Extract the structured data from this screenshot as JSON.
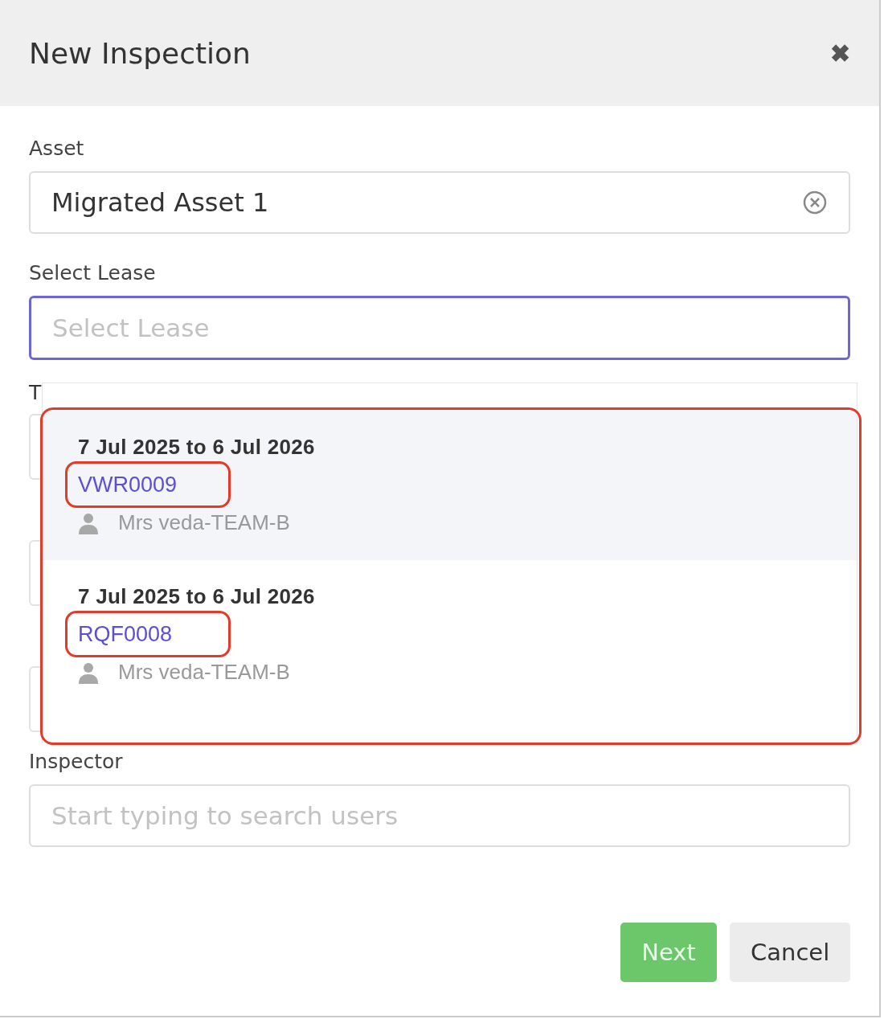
{
  "dialog": {
    "title": "New Inspection",
    "close": "✖"
  },
  "asset": {
    "label": "Asset",
    "value": "Migrated Asset 1"
  },
  "lease": {
    "label": "Select Lease",
    "placeholder": "Select Lease",
    "focused": true
  },
  "hidden_field": {
    "label": "T"
  },
  "lease_options": [
    {
      "dates": "7 Jul 2025 to 6 Jul 2026",
      "code": "VWR0009",
      "tenant": "Mrs veda-TEAM-B",
      "highlighted": true,
      "code_marked": true
    },
    {
      "dates": "7 Jul 2025 to 6 Jul 2026",
      "code": "RQF0008",
      "tenant": "Mrs veda-TEAM-B",
      "highlighted": false,
      "code_marked": true
    }
  ],
  "options_marked": true,
  "inspector": {
    "label": "Inspector",
    "placeholder": "Start typing to search users"
  },
  "buttons": [
    {
      "label": "Next",
      "kind": "primary"
    },
    {
      "label": "Cancel",
      "kind": "secondary"
    }
  ]
}
